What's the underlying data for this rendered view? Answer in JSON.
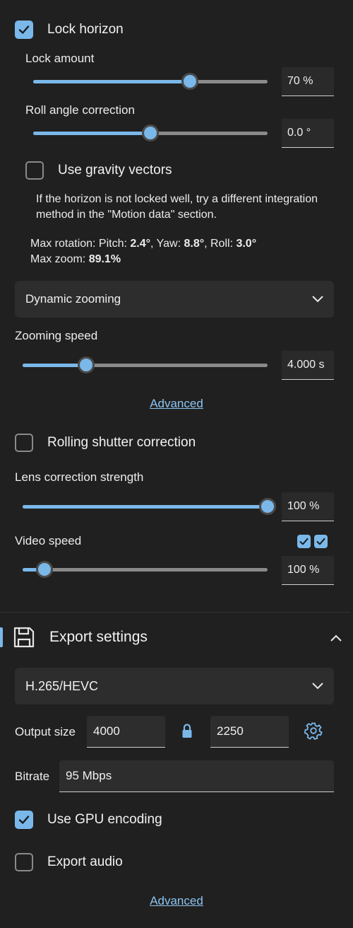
{
  "stabilization": {
    "lock_horizon": {
      "label": "Lock horizon",
      "checked": true
    },
    "lock_amount": {
      "label": "Lock amount",
      "value": "70 %",
      "fraction": 0.67
    },
    "roll_correction": {
      "label": "Roll angle correction",
      "value": "0.0 °",
      "fraction": 0.5
    },
    "gravity_vectors": {
      "label": "Use gravity vectors",
      "checked": false
    },
    "hint": "If the horizon is not locked well, try a different integration method in the \"Motion data\" section.",
    "max_rotation_prefix": "Max rotation: Pitch: ",
    "pitch": "2.4°",
    "yaw_label": ", Yaw: ",
    "yaw": "8.8°",
    "roll_label": ", Roll: ",
    "roll": "3.0°",
    "max_zoom_prefix": "Max zoom: ",
    "max_zoom": "89.1%",
    "zoom_mode": "Dynamic zooming",
    "zooming_speed": {
      "label": "Zooming speed",
      "value": "4.000 s",
      "fraction": 0.26
    },
    "advanced_link": "Advanced",
    "rolling_shutter": {
      "label": "Rolling shutter correction",
      "checked": false
    },
    "lens_strength": {
      "label": "Lens correction strength",
      "value": "100 %",
      "fraction": 1.0
    },
    "video_speed": {
      "label": "Video speed",
      "value": "100 %",
      "fraction": 0.09
    }
  },
  "export": {
    "title": "Export settings",
    "codec": "H.265/HEVC",
    "output_size_label": "Output size",
    "width": "4000",
    "height": "2250",
    "bitrate_label": "Bitrate",
    "bitrate": "95 Mbps",
    "gpu_encoding": {
      "label": "Use GPU encoding",
      "checked": true
    },
    "export_audio": {
      "label": "Export audio",
      "checked": false
    },
    "advanced_link": "Advanced"
  },
  "colors": {
    "accent": "#7ab8ea",
    "background": "#202020",
    "panel": "#2d2d2d"
  },
  "icons": [
    "check-icon",
    "chevron-down-icon",
    "chevron-up-icon",
    "save-icon",
    "lock-icon",
    "gear-icon"
  ]
}
